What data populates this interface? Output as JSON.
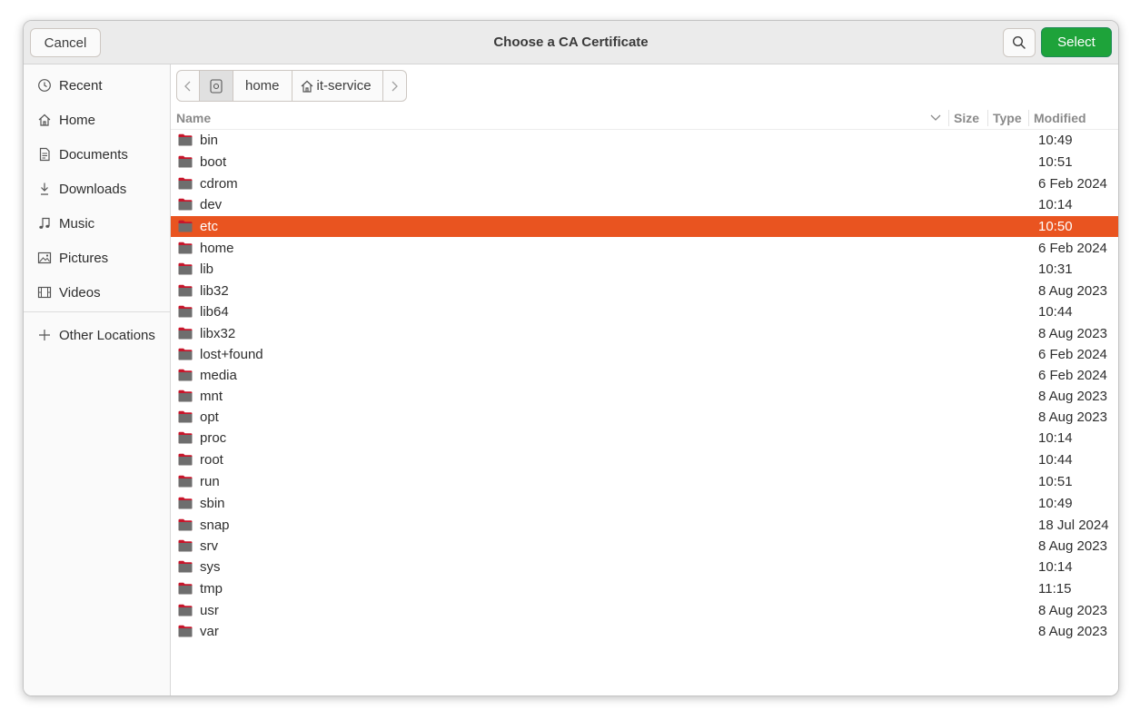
{
  "dialog": {
    "title": "Choose a CA Certificate",
    "cancel_label": "Cancel",
    "select_label": "Select",
    "accent_color": "#e95420",
    "select_color": "#1ea33a"
  },
  "sidebar": {
    "items": [
      {
        "label": "Recent",
        "icon": "clock-icon"
      },
      {
        "label": "Home",
        "icon": "home-icon"
      },
      {
        "label": "Documents",
        "icon": "document-icon"
      },
      {
        "label": "Downloads",
        "icon": "download-icon"
      },
      {
        "label": "Music",
        "icon": "music-icon"
      },
      {
        "label": "Pictures",
        "icon": "picture-icon"
      },
      {
        "label": "Videos",
        "icon": "video-icon"
      }
    ],
    "other_locations": {
      "label": "Other Locations",
      "icon": "plus-icon"
    }
  },
  "pathbar": {
    "segments": [
      "home",
      "it-service"
    ]
  },
  "columns": {
    "name": "Name",
    "size": "Size",
    "type": "Type",
    "modified": "Modified"
  },
  "files": [
    {
      "name": "bin",
      "modified": "10:49"
    },
    {
      "name": "boot",
      "modified": "10:51"
    },
    {
      "name": "cdrom",
      "modified": "6 Feb 2024"
    },
    {
      "name": "dev",
      "modified": "10:14"
    },
    {
      "name": "etc",
      "modified": "10:50",
      "selected": true
    },
    {
      "name": "home",
      "modified": "6 Feb 2024"
    },
    {
      "name": "lib",
      "modified": "10:31"
    },
    {
      "name": "lib32",
      "modified": "8 Aug 2023"
    },
    {
      "name": "lib64",
      "modified": "10:44"
    },
    {
      "name": "libx32",
      "modified": "8 Aug 2023"
    },
    {
      "name": "lost+found",
      "modified": "6 Feb 2024"
    },
    {
      "name": "media",
      "modified": "6 Feb 2024"
    },
    {
      "name": "mnt",
      "modified": "8 Aug 2023"
    },
    {
      "name": "opt",
      "modified": "8 Aug 2023"
    },
    {
      "name": "proc",
      "modified": "10:14"
    },
    {
      "name": "root",
      "modified": "10:44"
    },
    {
      "name": "run",
      "modified": "10:51"
    },
    {
      "name": "sbin",
      "modified": "10:49"
    },
    {
      "name": "snap",
      "modified": "18 Jul 2024"
    },
    {
      "name": "srv",
      "modified": "8 Aug 2023"
    },
    {
      "name": "sys",
      "modified": "10:14"
    },
    {
      "name": "tmp",
      "modified": "11:15"
    },
    {
      "name": "usr",
      "modified": "8 Aug 2023"
    },
    {
      "name": "var",
      "modified": "8 Aug 2023"
    }
  ]
}
